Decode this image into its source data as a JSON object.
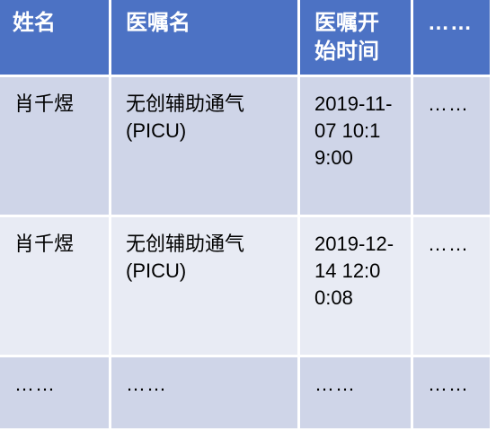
{
  "table": {
    "headers": [
      "姓名",
      "医嘱名",
      "医嘱开始时间",
      "……"
    ],
    "rows": [
      {
        "name": "肖千煜",
        "order": "无创辅助通气(PICU)",
        "time": "2019-11-07 10:19:00",
        "more": "……"
      },
      {
        "name": "肖千煜",
        "order": "无创辅助通气(PICU)",
        "time": "2019-12-14 12:00:08",
        "more": "……"
      },
      {
        "name": "……",
        "order": "……",
        "time": "……",
        "more": "……"
      }
    ]
  },
  "colors": {
    "header_bg": "#4c72c4",
    "row_odd_bg": "#cfd5e8",
    "row_even_bg": "#e8ebf4"
  }
}
